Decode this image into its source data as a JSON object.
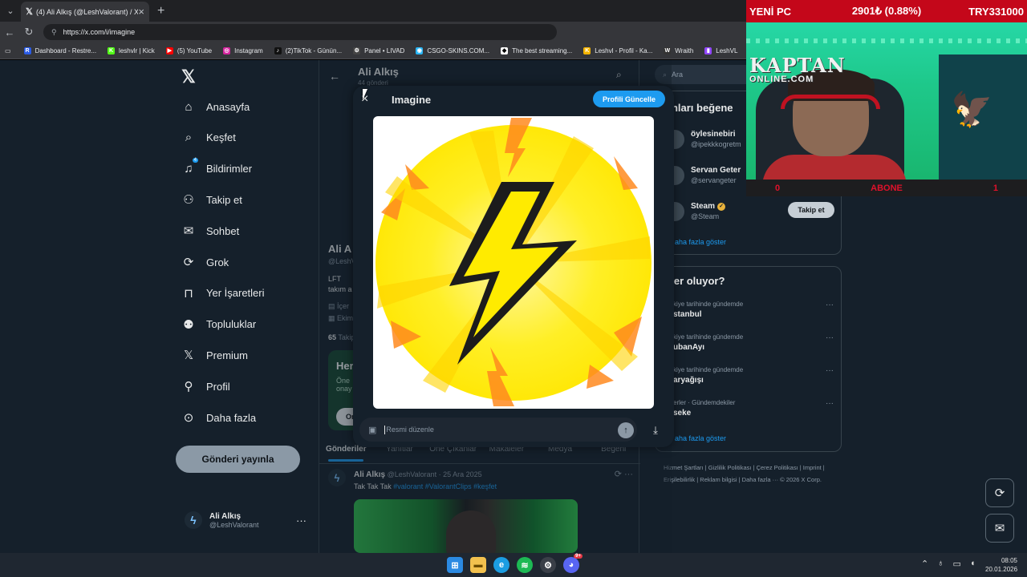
{
  "browser": {
    "tab_title": "(4) Ali Alkış (@LeshValorant) / X",
    "tab_favicon": "x-logo",
    "url": "https://x.com/i/imagine",
    "bookmarks": [
      {
        "label": "Dashboard - Restre...",
        "color": "#2b5ce6",
        "glyph": "R"
      },
      {
        "label": "leshvlr | Kick",
        "color": "#53fc18",
        "glyph": "K"
      },
      {
        "label": "(5) YouTube",
        "color": "#ff0000",
        "glyph": "▶"
      },
      {
        "label": "Instagram",
        "color": "#d6249f",
        "glyph": "◎"
      },
      {
        "label": "(2)TikTok - Günün...",
        "color": "#111111",
        "glyph": "♪"
      },
      {
        "label": "Panel • LIVAD",
        "color": "#444444",
        "glyph": "⚙"
      },
      {
        "label": "CSGO-SKINS.COM...",
        "color": "#29b6f6",
        "glyph": "◉"
      },
      {
        "label": "The best streaming...",
        "color": "#ffffff",
        "glyph": "◆"
      },
      {
        "label": "Leshvl - Profil - Ka...",
        "color": "#f4b400",
        "glyph": "K"
      },
      {
        "label": "Wraith",
        "color": "#333333",
        "glyph": "W"
      },
      {
        "label": "LeshVL",
        "color": "#9146ff",
        "glyph": "▮"
      }
    ]
  },
  "nav": {
    "items": [
      {
        "label": "Anasayfa",
        "icon": "home-icon"
      },
      {
        "label": "Keşfet",
        "icon": "search-icon"
      },
      {
        "label": "Bildirimler",
        "icon": "bell-icon",
        "badge": "4"
      },
      {
        "label": "Takip et",
        "icon": "add-user-icon"
      },
      {
        "label": "Sohbet",
        "icon": "mail-icon"
      },
      {
        "label": "Grok",
        "icon": "grok-icon"
      },
      {
        "label": "Yer İşaretleri",
        "icon": "bookmark-icon"
      },
      {
        "label": "Topluluklar",
        "icon": "communities-icon"
      },
      {
        "label": "Premium",
        "icon": "x-premium-icon"
      },
      {
        "label": "Profil",
        "icon": "profile-icon"
      },
      {
        "label": "Daha fazla",
        "icon": "more-circle-icon"
      }
    ],
    "post_button": "Gönderi yayınla",
    "account_name": "Ali Alkış",
    "account_handle": "@LeshValorant"
  },
  "feed": {
    "title": "Ali Alkış",
    "subtitle": "44 gönderi",
    "profile_name": "Ali A",
    "profile_handle": "@LeshV",
    "bio_line1": "LFT",
    "bio_line2": "takım a",
    "meta1": "İçer",
    "meta2": "Ekim",
    "following_count": "65",
    "following_label": "Takip",
    "promo_title": "Her",
    "promo_text1": "Öne",
    "promo_text2": "onay",
    "promo_button": "Or",
    "tabs": [
      "Gönderiler",
      "Yanıtlar",
      "Öne Çıkanlar",
      "Makaleler",
      "Medya",
      "Beğeni"
    ],
    "tweet": {
      "name": "Ali Alkış",
      "handle_date": "@LeshValorant · 25 Ara 2025",
      "text": "Tak Tak Tak ",
      "tags": "#valorant #ValorantClips #keşfet"
    }
  },
  "right": {
    "search_placeholder": "Ara",
    "who_title": "unları beğene",
    "who": [
      {
        "name": "öylesinebiri",
        "handle": "@ipekkkogretm",
        "verified": false
      },
      {
        "name": "Servan Geter",
        "handle": "@servangeter",
        "verified": false
      },
      {
        "name": "Steam",
        "handle": "@Steam",
        "verified": true,
        "follow": "Takip et"
      }
    ],
    "who_more": "aha fazla göster",
    "trends_title": "eler oluyor?",
    "trends": [
      {
        "ctx": "kiye tarihinde gündemde",
        "name": "stanbul"
      },
      {
        "ctx": "kiye tarihinde gündemde",
        "name": "ubanAyı"
      },
      {
        "ctx": "kiye tarihinde gündemde",
        "name": "aryağışı"
      },
      {
        "ctx": "erler · Gündemdekiler",
        "name": "seke"
      }
    ],
    "trends_more": "aha fazla göster",
    "footer": "Hizmet Şartları | Gizlilik Politikası | Çerez Politikası | Imprint | Erişilebilirlik | Reklam bilgisi | Daha fazla ··· © 2026 X Corp."
  },
  "modal": {
    "title": "Imagine",
    "update_button": "Profili Güncelle",
    "input_placeholder": "Resmi düzenle",
    "image_alt": "lightning-bolt-on-yellow-circle"
  },
  "stream": {
    "left": "YENİ PC",
    "center": "2901₺ (0.88%)",
    "right": "TRY331000",
    "brand_line1": "KAPTAN",
    "brand_line2": "ONLINE.COM",
    "foot_left": "0",
    "foot_center": "ABONE",
    "foot_right": "1"
  },
  "taskbar": {
    "time": "08:05",
    "date": "20.01.2026",
    "discord_badge": "9+"
  },
  "colors": {
    "accent": "#1d9bf0",
    "page_bg": "#15202b",
    "stream_red": "#c4071a",
    "bolt_yellow": "#ffea00"
  }
}
